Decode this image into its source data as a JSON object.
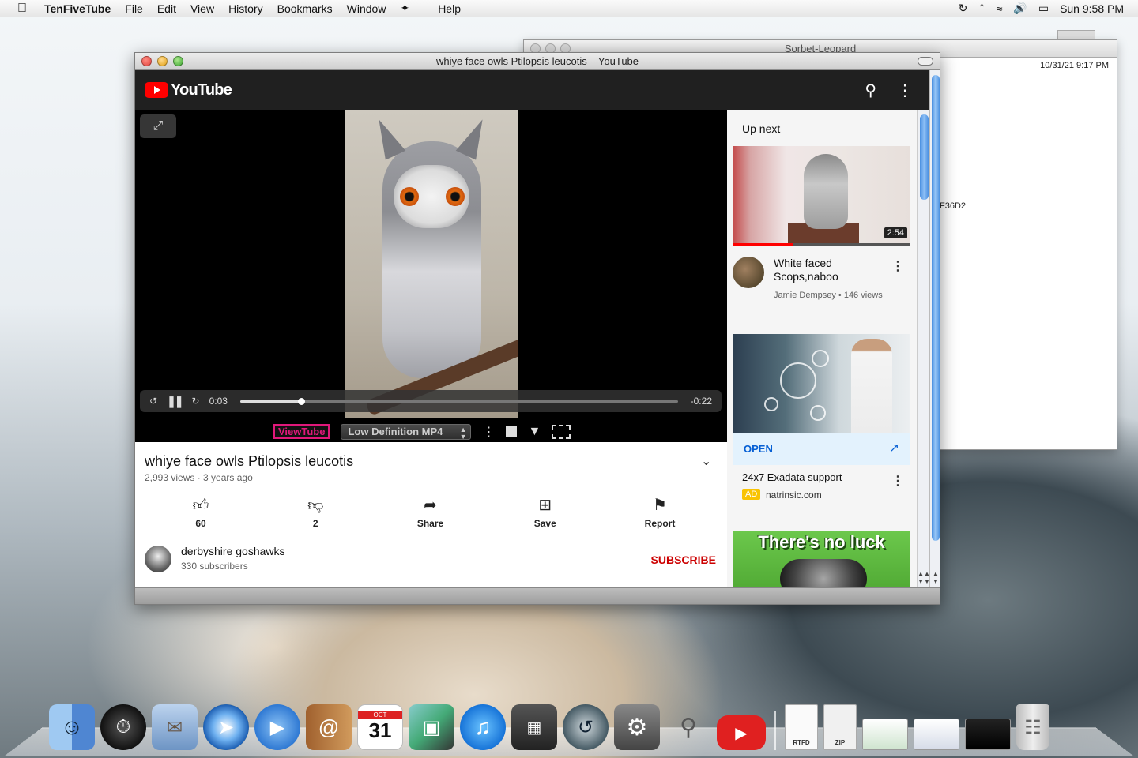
{
  "menubar": {
    "app_name": "TenFiveTube",
    "menus": [
      "File",
      "Edit",
      "View",
      "History",
      "Bookmarks",
      "Window",
      "Help"
    ],
    "clock": "Sun 9:58 PM"
  },
  "back_window": {
    "title": "Sorbet-Leopard",
    "timestamp": "10/31/21 9:17 PM",
    "code_fragment": "F36D2"
  },
  "main_window": {
    "title": "whiye face owls Ptilopsis leucotis – YouTube"
  },
  "youtube": {
    "logo_text": "YouTube"
  },
  "player": {
    "current_time": "0:03",
    "remaining_time": "-0:22",
    "progress_fraction": 0.14
  },
  "viewtube": {
    "label": "ViewTube",
    "format": "Low Definition MP4"
  },
  "video": {
    "title": "whiye face owls Ptilopsis leucotis",
    "meta": "2,993 views · 3 years ago",
    "actions": {
      "like": "60",
      "dislike": "2",
      "share": "Share",
      "save": "Save",
      "report": "Report"
    }
  },
  "channel": {
    "name": "derbyshire goshawks",
    "subscribers": "330 subscribers",
    "subscribe_label": "SUBSCRIBE"
  },
  "sidebar": {
    "heading": "Up next",
    "recommendation": {
      "duration": "2:54",
      "title": "White faced Scops,naboo",
      "byline": "Jamie Dempsey • 146 views",
      "watched_fraction": 0.34
    },
    "ad": {
      "open_label": "OPEN",
      "title": "24x7 Exadata support",
      "badge": "AD",
      "domain": "natrinsic.com"
    },
    "ad2": {
      "headline": "There's no luck"
    }
  },
  "dock": {
    "calendar_month": "OCT",
    "calendar_day": "31",
    "rtfd_label": "RTFD",
    "zip_label": "ZIP"
  }
}
